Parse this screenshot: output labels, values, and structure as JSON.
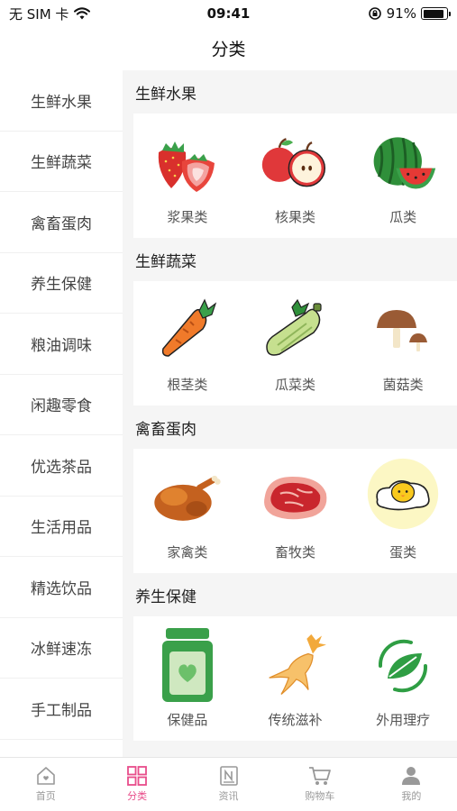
{
  "status": {
    "carrier": "无 SIM 卡",
    "time": "09:41",
    "battery": "91%",
    "battery_level": 0.91
  },
  "nav": {
    "title": "分类"
  },
  "sidebar": {
    "items": [
      {
        "label": "生鲜水果"
      },
      {
        "label": "生鲜蔬菜"
      },
      {
        "label": "禽畜蛋肉"
      },
      {
        "label": "养生保健"
      },
      {
        "label": "粮油调味"
      },
      {
        "label": "闲趣零食"
      },
      {
        "label": "优选茶品"
      },
      {
        "label": "生活用品"
      },
      {
        "label": "精选饮品"
      },
      {
        "label": "冰鲜速冻"
      },
      {
        "label": "手工制品"
      }
    ]
  },
  "sections": [
    {
      "title": "生鲜水果",
      "items": [
        {
          "label": "浆果类",
          "icon": "strawberry-icon"
        },
        {
          "label": "核果类",
          "icon": "apple-icon"
        },
        {
          "label": "瓜类",
          "icon": "watermelon-icon"
        }
      ]
    },
    {
      "title": "生鲜蔬菜",
      "items": [
        {
          "label": "根茎类",
          "icon": "carrot-icon"
        },
        {
          "label": "瓜菜类",
          "icon": "zucchini-icon"
        },
        {
          "label": "菌菇类",
          "icon": "mushroom-icon"
        }
      ]
    },
    {
      "title": "禽畜蛋肉",
      "items": [
        {
          "label": "家禽类",
          "icon": "roast-chicken-icon"
        },
        {
          "label": "畜牧类",
          "icon": "meat-icon"
        },
        {
          "label": "蛋类",
          "icon": "egg-icon"
        }
      ]
    },
    {
      "title": "养生保健",
      "items": [
        {
          "label": "保健品",
          "icon": "supplement-jar-icon"
        },
        {
          "label": "传统滋补",
          "icon": "ginseng-icon"
        },
        {
          "label": "外用理疗",
          "icon": "leaf-icon"
        }
      ]
    }
  ],
  "tabbar": {
    "items": [
      {
        "label": "首页",
        "icon": "home-icon"
      },
      {
        "label": "分类",
        "icon": "category-grid-icon"
      },
      {
        "label": "资讯",
        "icon": "news-icon"
      },
      {
        "label": "购物车",
        "icon": "cart-icon"
      },
      {
        "label": "我的",
        "icon": "user-icon"
      }
    ],
    "active_index": 1
  },
  "colors": {
    "accent": "#e84d8a",
    "content_bg": "#f5f5f5"
  }
}
